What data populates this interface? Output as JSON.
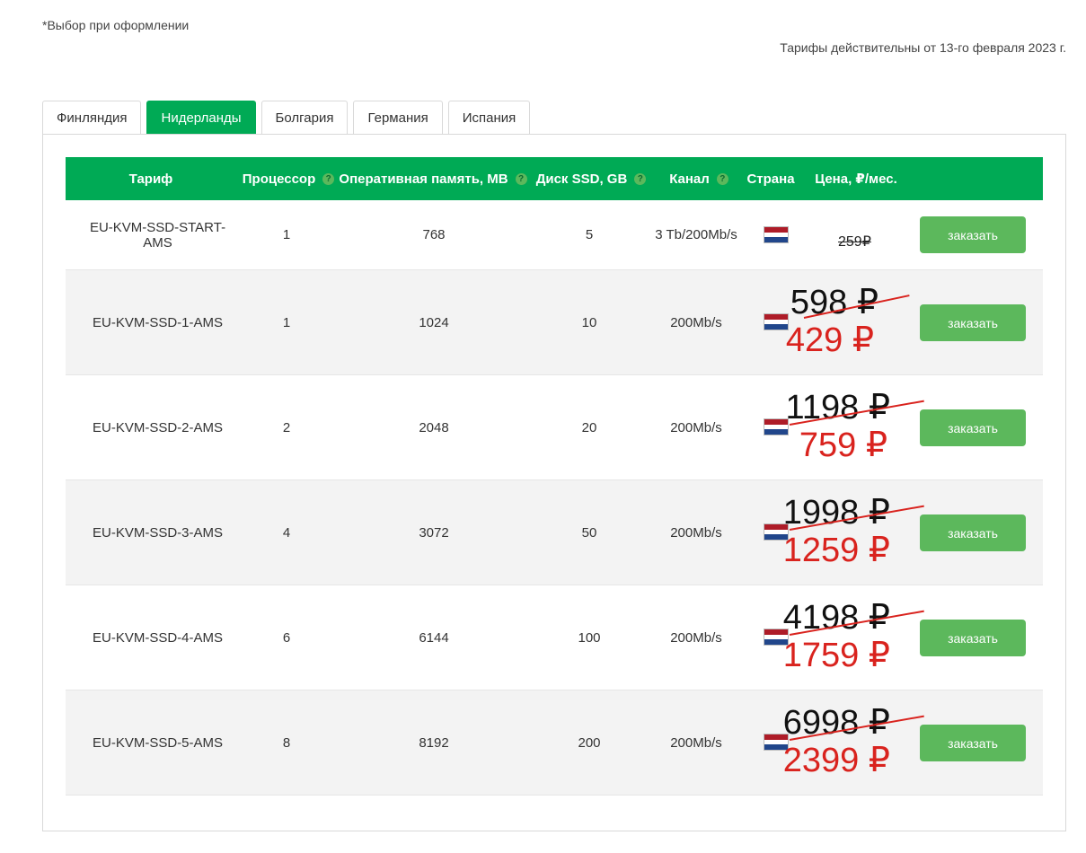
{
  "note": "*Выбор при оформлении",
  "valid_from": "Тарифы действительны от 13-го февраля 2023 г.",
  "tabs": [
    {
      "label": "Финляндия",
      "active": false
    },
    {
      "label": "Нидерланды",
      "active": true
    },
    {
      "label": "Болгария",
      "active": false
    },
    {
      "label": "Германия",
      "active": false
    },
    {
      "label": "Испания",
      "active": false
    }
  ],
  "columns": {
    "tariff": "Тариф",
    "cpu": "Процессор",
    "ram": "Оперативная память, MB",
    "disk": "Диск SSD, GB",
    "channel": "Канал",
    "country": "Страна",
    "price": "Цена, ₽/мес."
  },
  "help_icon": "?",
  "order_label": "заказать",
  "colors": {
    "accent": "#00aa55",
    "button": "#5cb85c",
    "discount": "#d9231e"
  },
  "rows": [
    {
      "name": "EU-KVM-SSD-START-AMS",
      "cpu": "1",
      "ram": "768",
      "disk": "5",
      "channel": "3 Tb/200Mb/s",
      "country_icon": "netherlands-flag-icon",
      "old_price": "259₽"
    },
    {
      "name": "EU-KVM-SSD-1-AMS",
      "cpu": "1",
      "ram": "1024",
      "disk": "10",
      "channel": "200Mb/s",
      "country_icon": "netherlands-flag-icon",
      "old_price": "598 ₽",
      "new_price": "429 ₽"
    },
    {
      "name": "EU-KVM-SSD-2-AMS",
      "cpu": "2",
      "ram": "2048",
      "disk": "20",
      "channel": "200Mb/s",
      "country_icon": "netherlands-flag-icon",
      "old_price": "1198 ₽",
      "new_price": "759 ₽"
    },
    {
      "name": "EU-KVM-SSD-3-AMS",
      "cpu": "4",
      "ram": "3072",
      "disk": "50",
      "channel": "200Mb/s",
      "country_icon": "netherlands-flag-icon",
      "old_price": "1998 ₽",
      "new_price": "1259 ₽"
    },
    {
      "name": "EU-KVM-SSD-4-AMS",
      "cpu": "6",
      "ram": "6144",
      "disk": "100",
      "channel": "200Mb/s",
      "country_icon": "netherlands-flag-icon",
      "old_price": "4198 ₽",
      "new_price": "1759 ₽"
    },
    {
      "name": "EU-KVM-SSD-5-AMS",
      "cpu": "8",
      "ram": "8192",
      "disk": "200",
      "channel": "200Mb/s",
      "country_icon": "netherlands-flag-icon",
      "old_price": "6998 ₽",
      "new_price": "2399 ₽"
    }
  ]
}
